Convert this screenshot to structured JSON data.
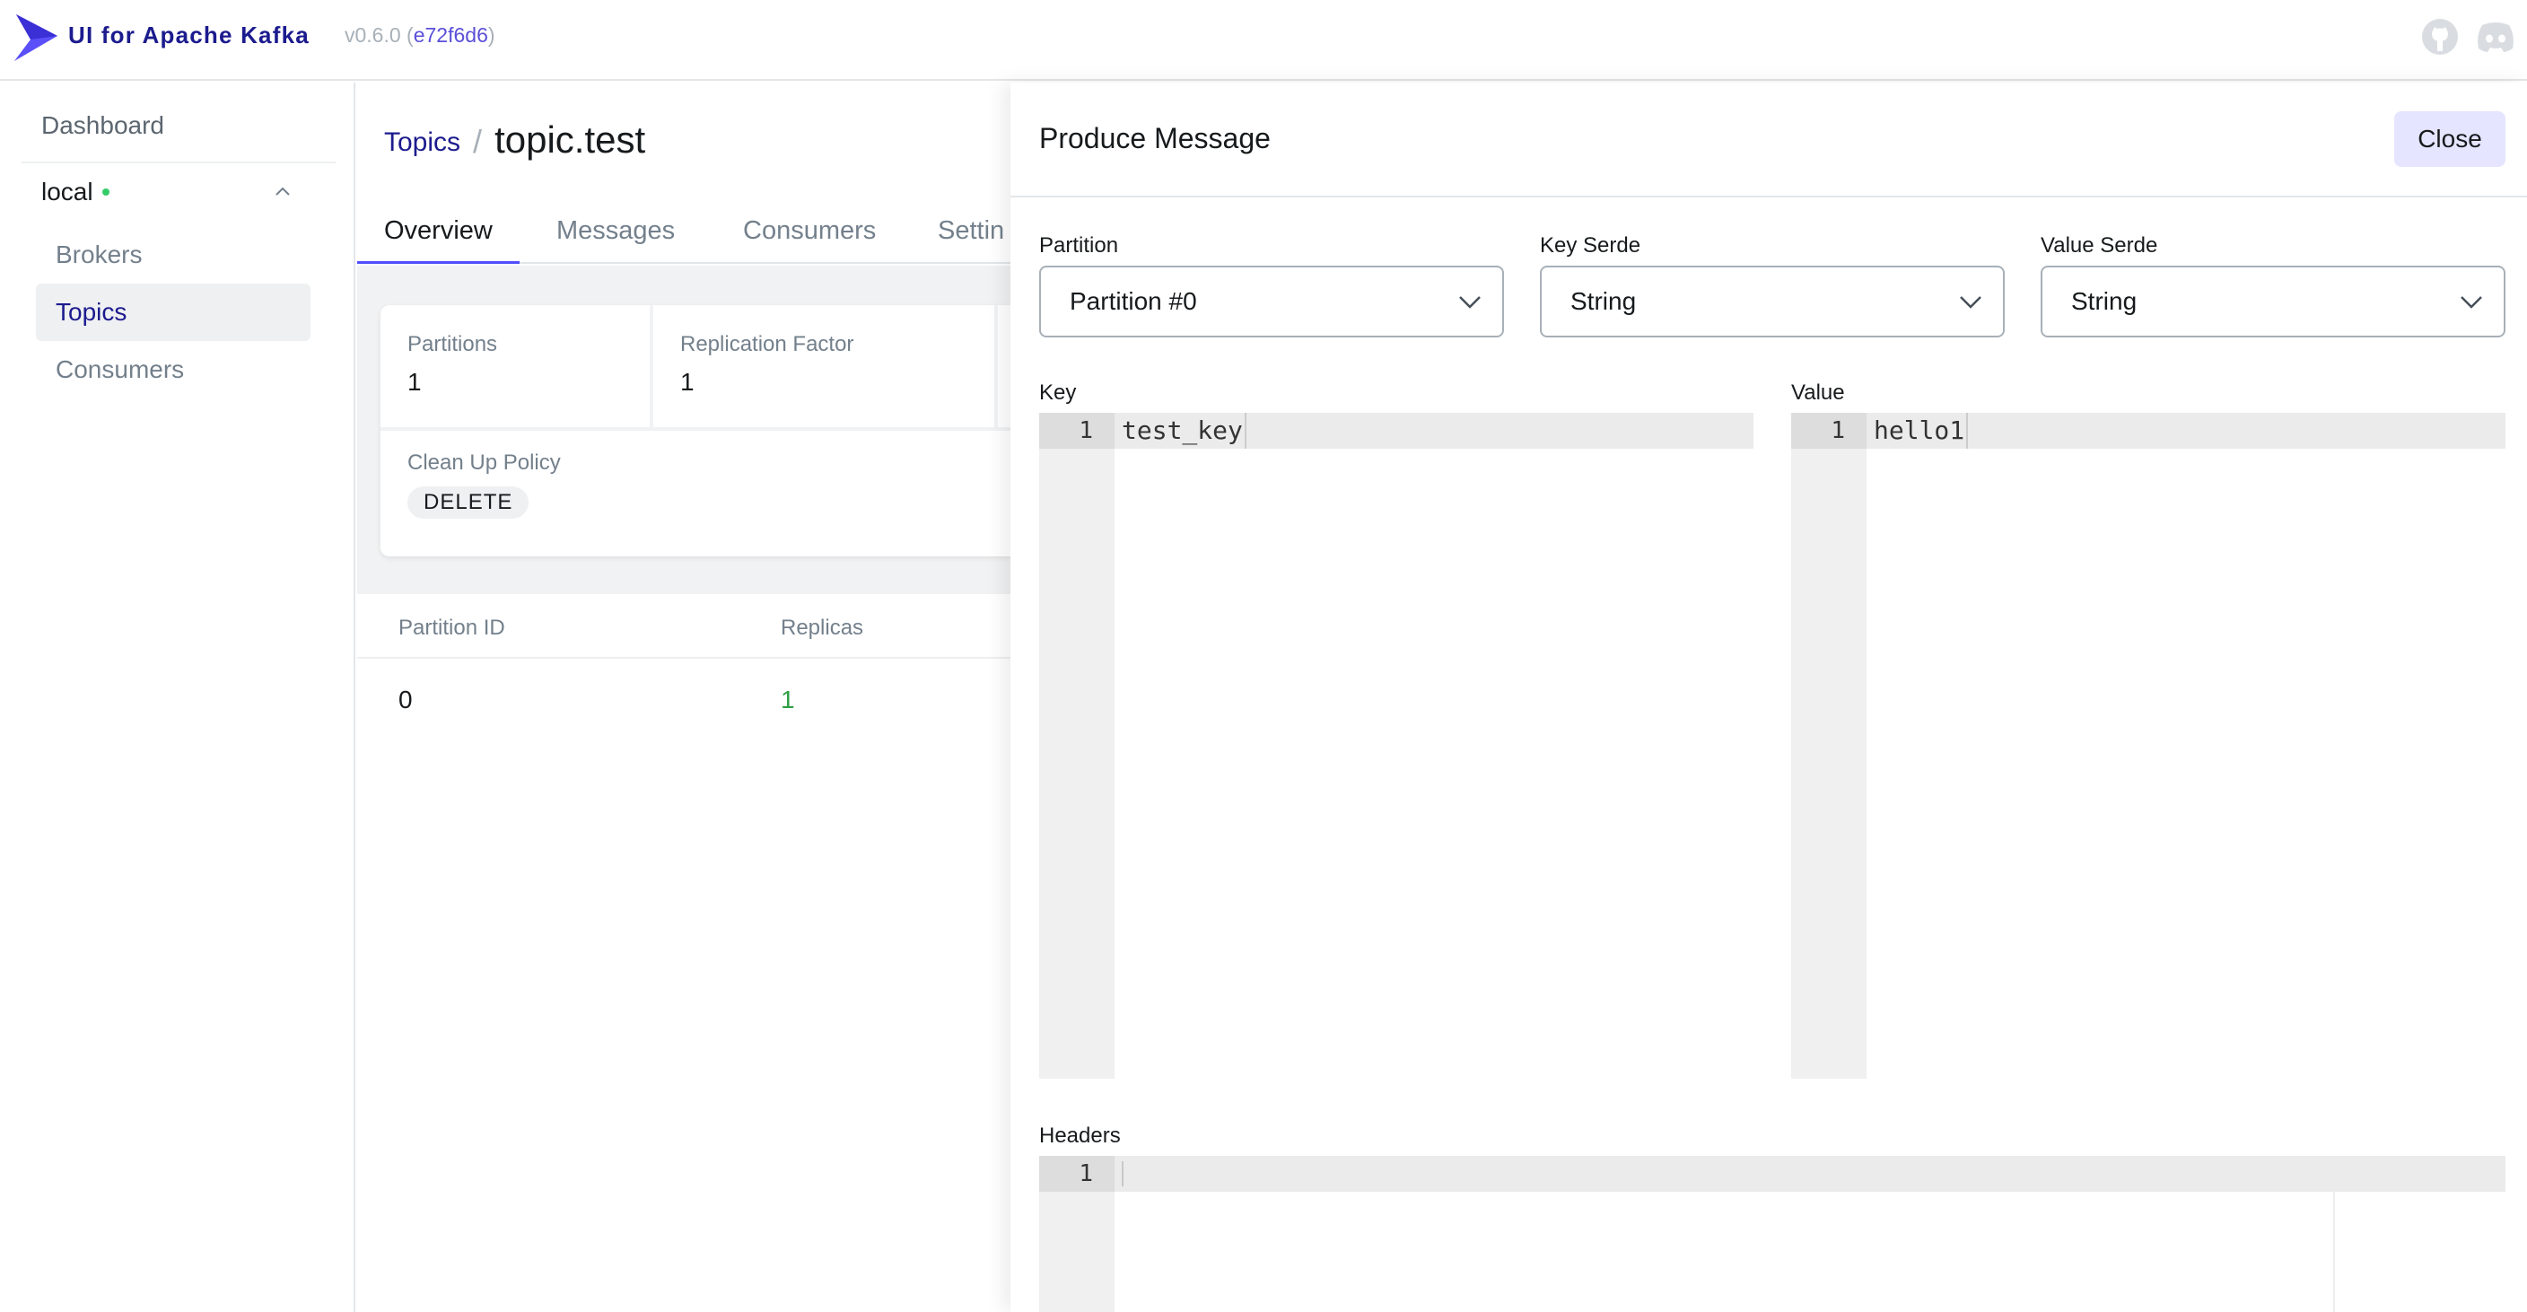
{
  "header": {
    "brand": "UI for Apache Kafka",
    "version_prefix": "v0.6.0 (",
    "version_hash": "e72f6d6",
    "version_suffix": ")",
    "brand_color": "#1C1B8E",
    "icons": [
      "kafka-logo-icon",
      "github-icon",
      "discord-icon"
    ]
  },
  "sidebar": {
    "dashboard": "Dashboard",
    "cluster": "local",
    "items": [
      {
        "label": "Brokers",
        "active": false
      },
      {
        "label": "Topics",
        "active": true
      },
      {
        "label": "Consumers",
        "active": false
      }
    ]
  },
  "main": {
    "breadcrumb": {
      "link": "Topics",
      "sep": "/",
      "current": "topic.test"
    },
    "tabs": [
      {
        "label": "Overview",
        "active": true
      },
      {
        "label": "Messages",
        "active": false
      },
      {
        "label": "Consumers",
        "active": false
      },
      {
        "label": "Settin",
        "active": false
      }
    ],
    "metrics": {
      "partitions": {
        "label": "Partitions",
        "value": "1"
      },
      "replication": {
        "label": "Replication Factor",
        "value": "1"
      },
      "cleanup": {
        "label": "Clean Up Policy",
        "value": "DELETE"
      }
    },
    "table": {
      "columns": [
        "Partition ID",
        "Replicas"
      ],
      "rows": [
        {
          "partition_id": "0",
          "replicas": "1"
        }
      ]
    }
  },
  "drawer": {
    "title": "Produce Message",
    "close_label": "Close",
    "partition": {
      "label": "Partition",
      "value": "Partition #0"
    },
    "key_serde": {
      "label": "Key Serde",
      "value": "String"
    },
    "value_serde": {
      "label": "Value Serde",
      "value": "String"
    },
    "key_editor": {
      "label": "Key",
      "line_no": "1",
      "text": "test_key"
    },
    "value_editor": {
      "label": "Value",
      "line_no": "1",
      "text": "hello1"
    },
    "headers_editor": {
      "label": "Headers",
      "line_no": "1",
      "text": ""
    }
  }
}
